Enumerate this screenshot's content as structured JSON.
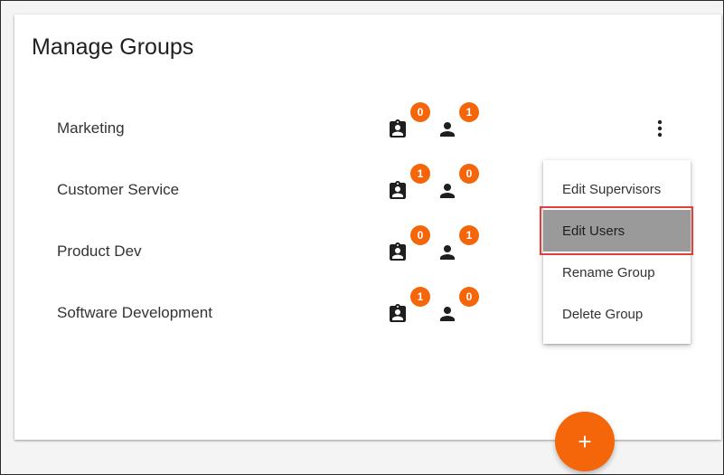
{
  "title": "Manage Groups",
  "groups": [
    {
      "name": "Marketing",
      "supervisors": "0",
      "users": "1"
    },
    {
      "name": "Customer Service",
      "supervisors": "1",
      "users": "0"
    },
    {
      "name": "Product Dev",
      "supervisors": "0",
      "users": "1"
    },
    {
      "name": "Software Development",
      "supervisors": "1",
      "users": "0"
    }
  ],
  "menu": {
    "items": [
      "Edit Supervisors",
      "Edit Users",
      "Rename Group",
      "Delete Group"
    ],
    "active_item": "Edit Users"
  },
  "icons": {
    "supervisor": "badge-icon",
    "user": "person-icon",
    "more": "more-vert-icon",
    "add": "plus-icon"
  },
  "fab": {
    "label": "+"
  },
  "colors": {
    "accent": "#f5660b",
    "active_menu": "#9a9a9a",
    "highlight": "#e0403a"
  }
}
